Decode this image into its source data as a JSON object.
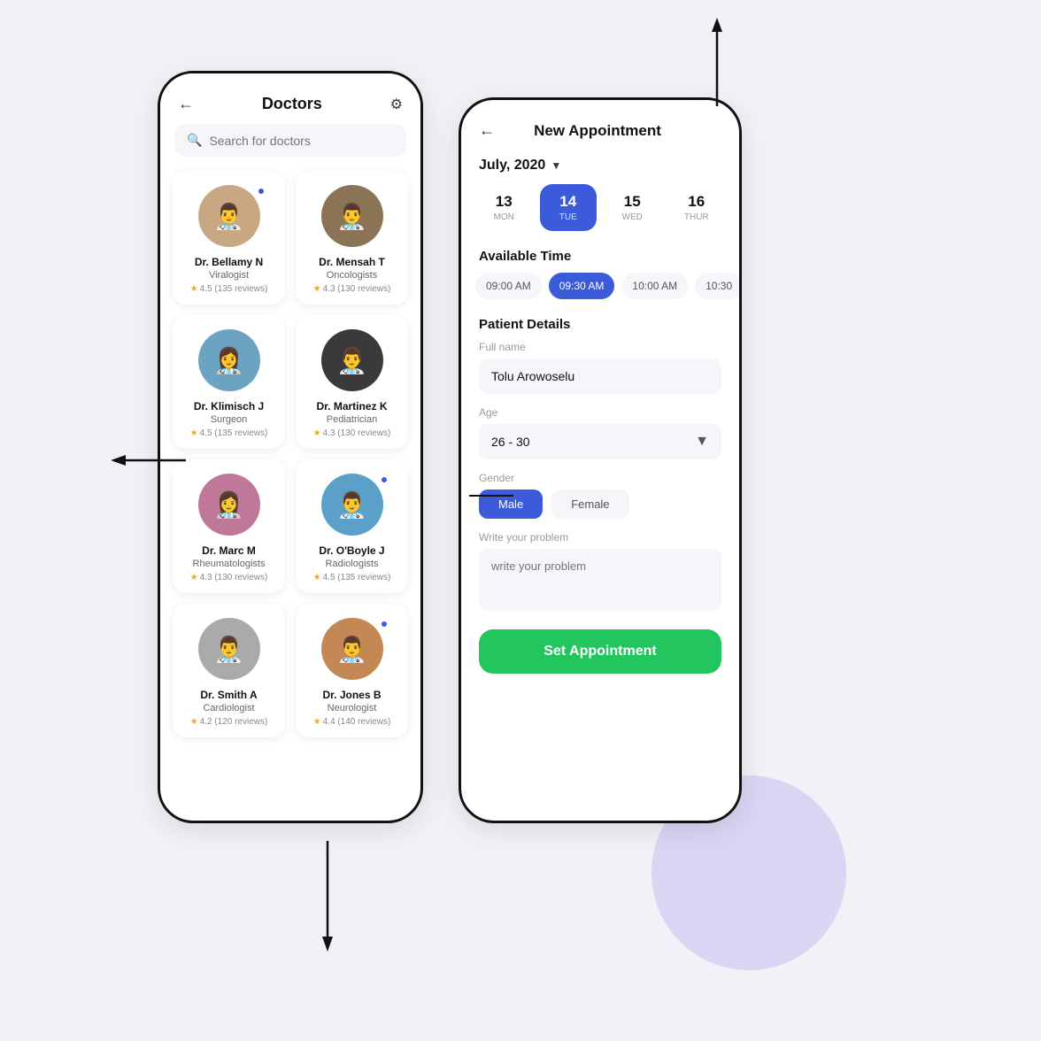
{
  "background": "#f0f2f7",
  "phone1": {
    "title": "Doctors",
    "back_label": "←",
    "filter_label": "⚙",
    "search_placeholder": "Search for doctors",
    "doctors": [
      {
        "name": "Dr. Bellamy N",
        "specialty": "Viralogist",
        "rating": "4.5",
        "reviews": "135 reviews",
        "online": true,
        "avatar_color": "#c8a882",
        "emoji": "👨‍⚕️"
      },
      {
        "name": "Dr. Mensah T",
        "specialty": "Oncologists",
        "rating": "4.3",
        "reviews": "130 reviews",
        "online": false,
        "avatar_color": "#8b7355",
        "emoji": "👨‍⚕️"
      },
      {
        "name": "Dr. Klimisch J",
        "specialty": "Surgeon",
        "rating": "4.5",
        "reviews": "135 reviews",
        "online": false,
        "avatar_color": "#6ba3c0",
        "emoji": "👩‍⚕️"
      },
      {
        "name": "Dr. Martinez K",
        "specialty": "Pediatrician",
        "rating": "4.3",
        "reviews": "130 reviews",
        "online": false,
        "avatar_color": "#3a3a3a",
        "emoji": "👨‍⚕️"
      },
      {
        "name": "Dr. Marc M",
        "specialty": "Rheumatologists",
        "rating": "4.3",
        "reviews": "130 reviews",
        "online": false,
        "avatar_color": "#c07898",
        "emoji": "👩‍⚕️"
      },
      {
        "name": "Dr. O'Boyle J",
        "specialty": "Radiologists",
        "rating": "4.5",
        "reviews": "135 reviews",
        "online": true,
        "avatar_color": "#5aa0c8",
        "emoji": "👨‍⚕️"
      },
      {
        "name": "Dr. Smith A",
        "specialty": "Cardiologist",
        "rating": "4.2",
        "reviews": "120 reviews",
        "online": false,
        "avatar_color": "#aaaaaa",
        "emoji": "👨‍⚕️"
      },
      {
        "name": "Dr. Jones B",
        "specialty": "Neurologist",
        "rating": "4.4",
        "reviews": "140 reviews",
        "online": true,
        "avatar_color": "#c48855",
        "emoji": "👨‍⚕️"
      }
    ]
  },
  "phone2": {
    "title": "New Appointment",
    "back_label": "←",
    "month": "July, 2020",
    "calendar": [
      {
        "num": "13",
        "name": "MON",
        "active": false
      },
      {
        "num": "14",
        "name": "TUE",
        "active": true
      },
      {
        "num": "15",
        "name": "WED",
        "active": false
      },
      {
        "num": "16",
        "name": "THUR",
        "active": false
      }
    ],
    "available_time_label": "Available Time",
    "time_slots": [
      {
        "time": "09:00 AM",
        "active": false
      },
      {
        "time": "09:30 AM",
        "active": true
      },
      {
        "time": "10:00 AM",
        "active": false
      },
      {
        "time": "10:30",
        "active": false
      }
    ],
    "patient_details_label": "Patient Details",
    "full_name_label": "Full name",
    "full_name_value": "Tolu Arowoselu",
    "age_label": "Age",
    "age_value": "26 - 30",
    "gender_label": "Gender",
    "gender_options": [
      {
        "label": "Male",
        "active": true
      },
      {
        "label": "Female",
        "active": false
      }
    ],
    "problem_label": "Write your problem",
    "problem_placeholder": "write your problem",
    "set_appointment_label": "Set Appointment"
  }
}
